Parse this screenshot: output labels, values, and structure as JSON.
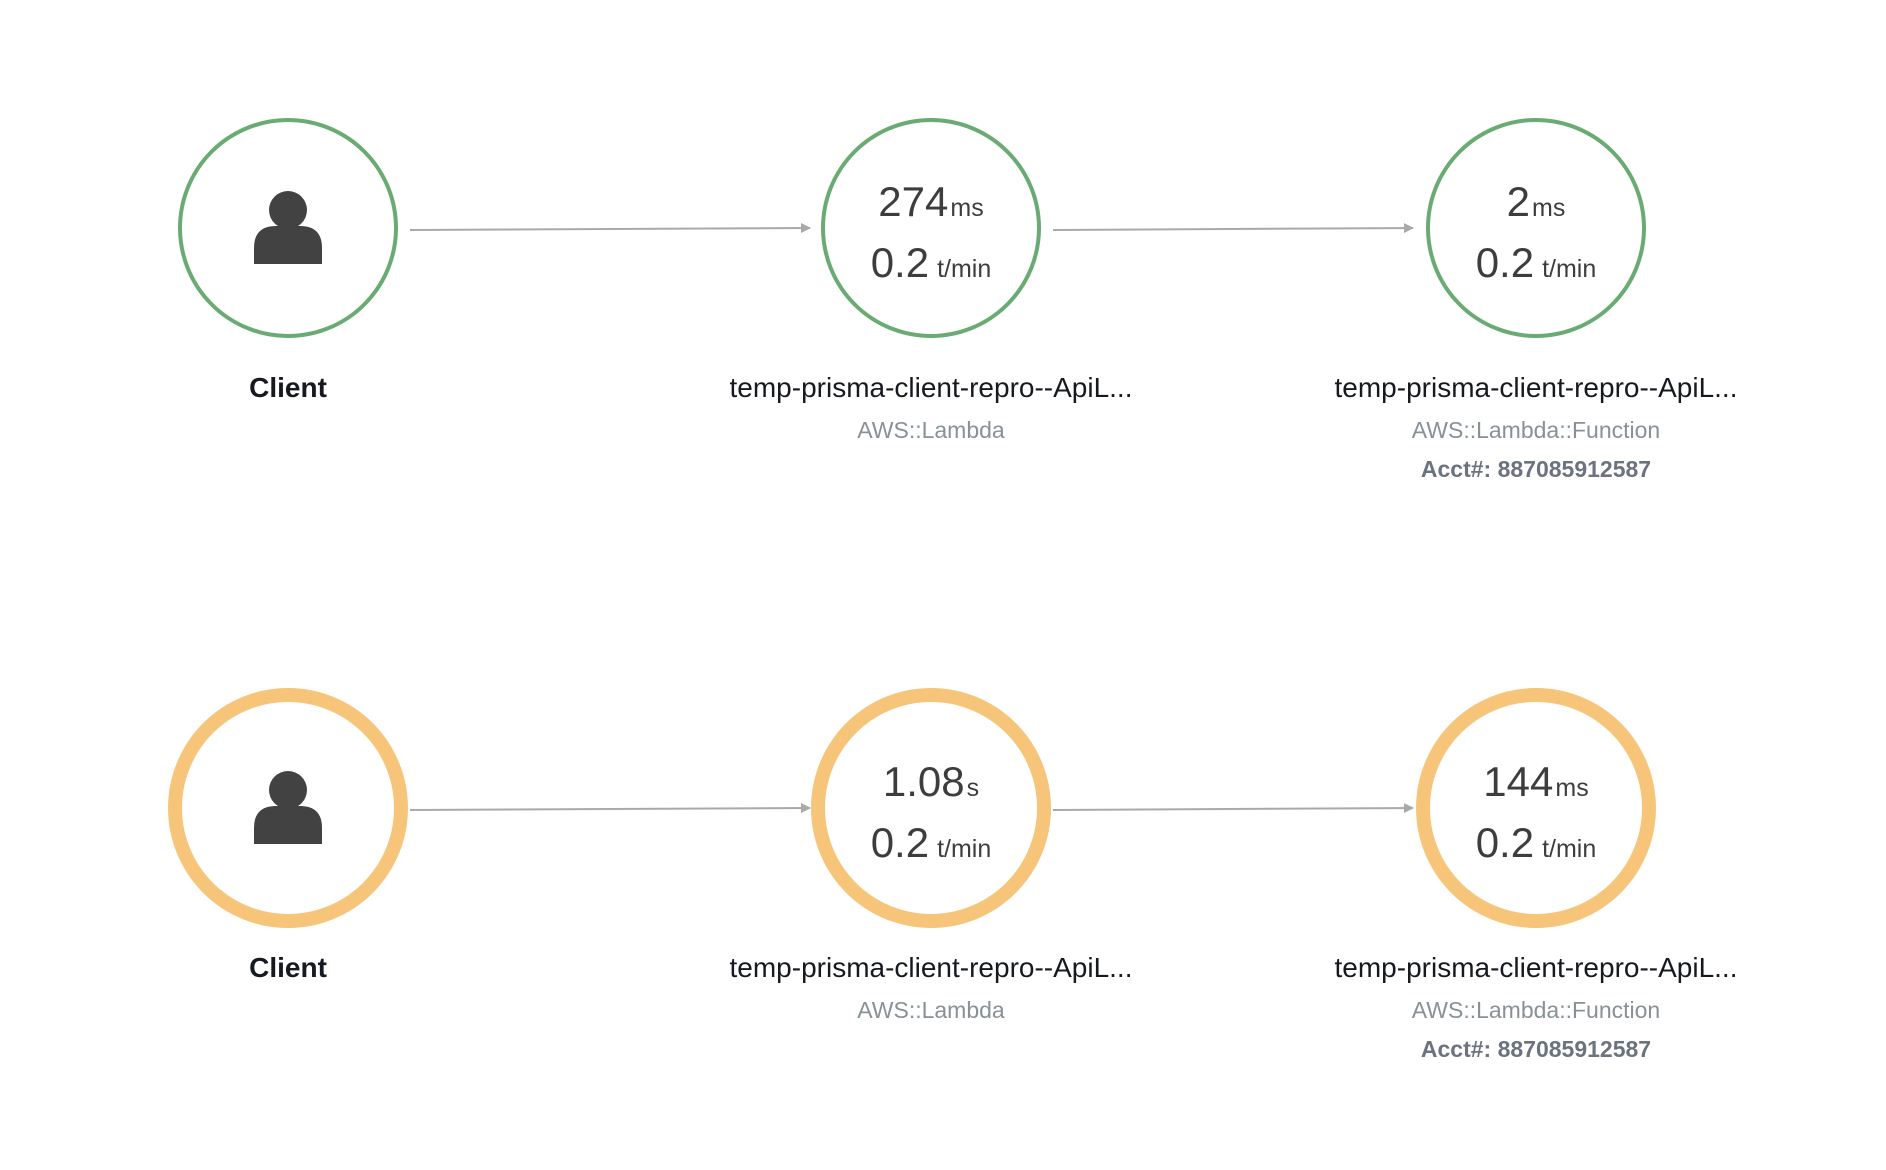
{
  "colors": {
    "ok": "#6aab73",
    "warn": "#f7c57a",
    "edge": "#a9a9a9",
    "icon": "#424242"
  },
  "rows": [
    {
      "status": "ok",
      "client": {
        "label": "Client",
        "icon": "user-icon"
      },
      "nodes": [
        {
          "latency_value": "274",
          "latency_unit": "ms",
          "rate_value": "0.2",
          "rate_unit": "t/min",
          "name": "temp-prisma-client-repro--ApiL...",
          "type": "AWS::Lambda",
          "acct": ""
        },
        {
          "latency_value": "2",
          "latency_unit": "ms",
          "rate_value": "0.2",
          "rate_unit": "t/min",
          "name": "temp-prisma-client-repro--ApiL...",
          "type": "AWS::Lambda::Function",
          "acct": "Acct#: 887085912587"
        }
      ]
    },
    {
      "status": "warn",
      "client": {
        "label": "Client",
        "icon": "user-icon"
      },
      "nodes": [
        {
          "latency_value": "1.08",
          "latency_unit": "s",
          "rate_value": "0.2",
          "rate_unit": "t/min",
          "name": "temp-prisma-client-repro--ApiL...",
          "type": "AWS::Lambda",
          "acct": ""
        },
        {
          "latency_value": "144",
          "latency_unit": "ms",
          "rate_value": "0.2",
          "rate_unit": "t/min",
          "name": "temp-prisma-client-repro--ApiL...",
          "type": "AWS::Lambda::Function",
          "acct": "Acct#: 887085912587"
        }
      ]
    }
  ]
}
